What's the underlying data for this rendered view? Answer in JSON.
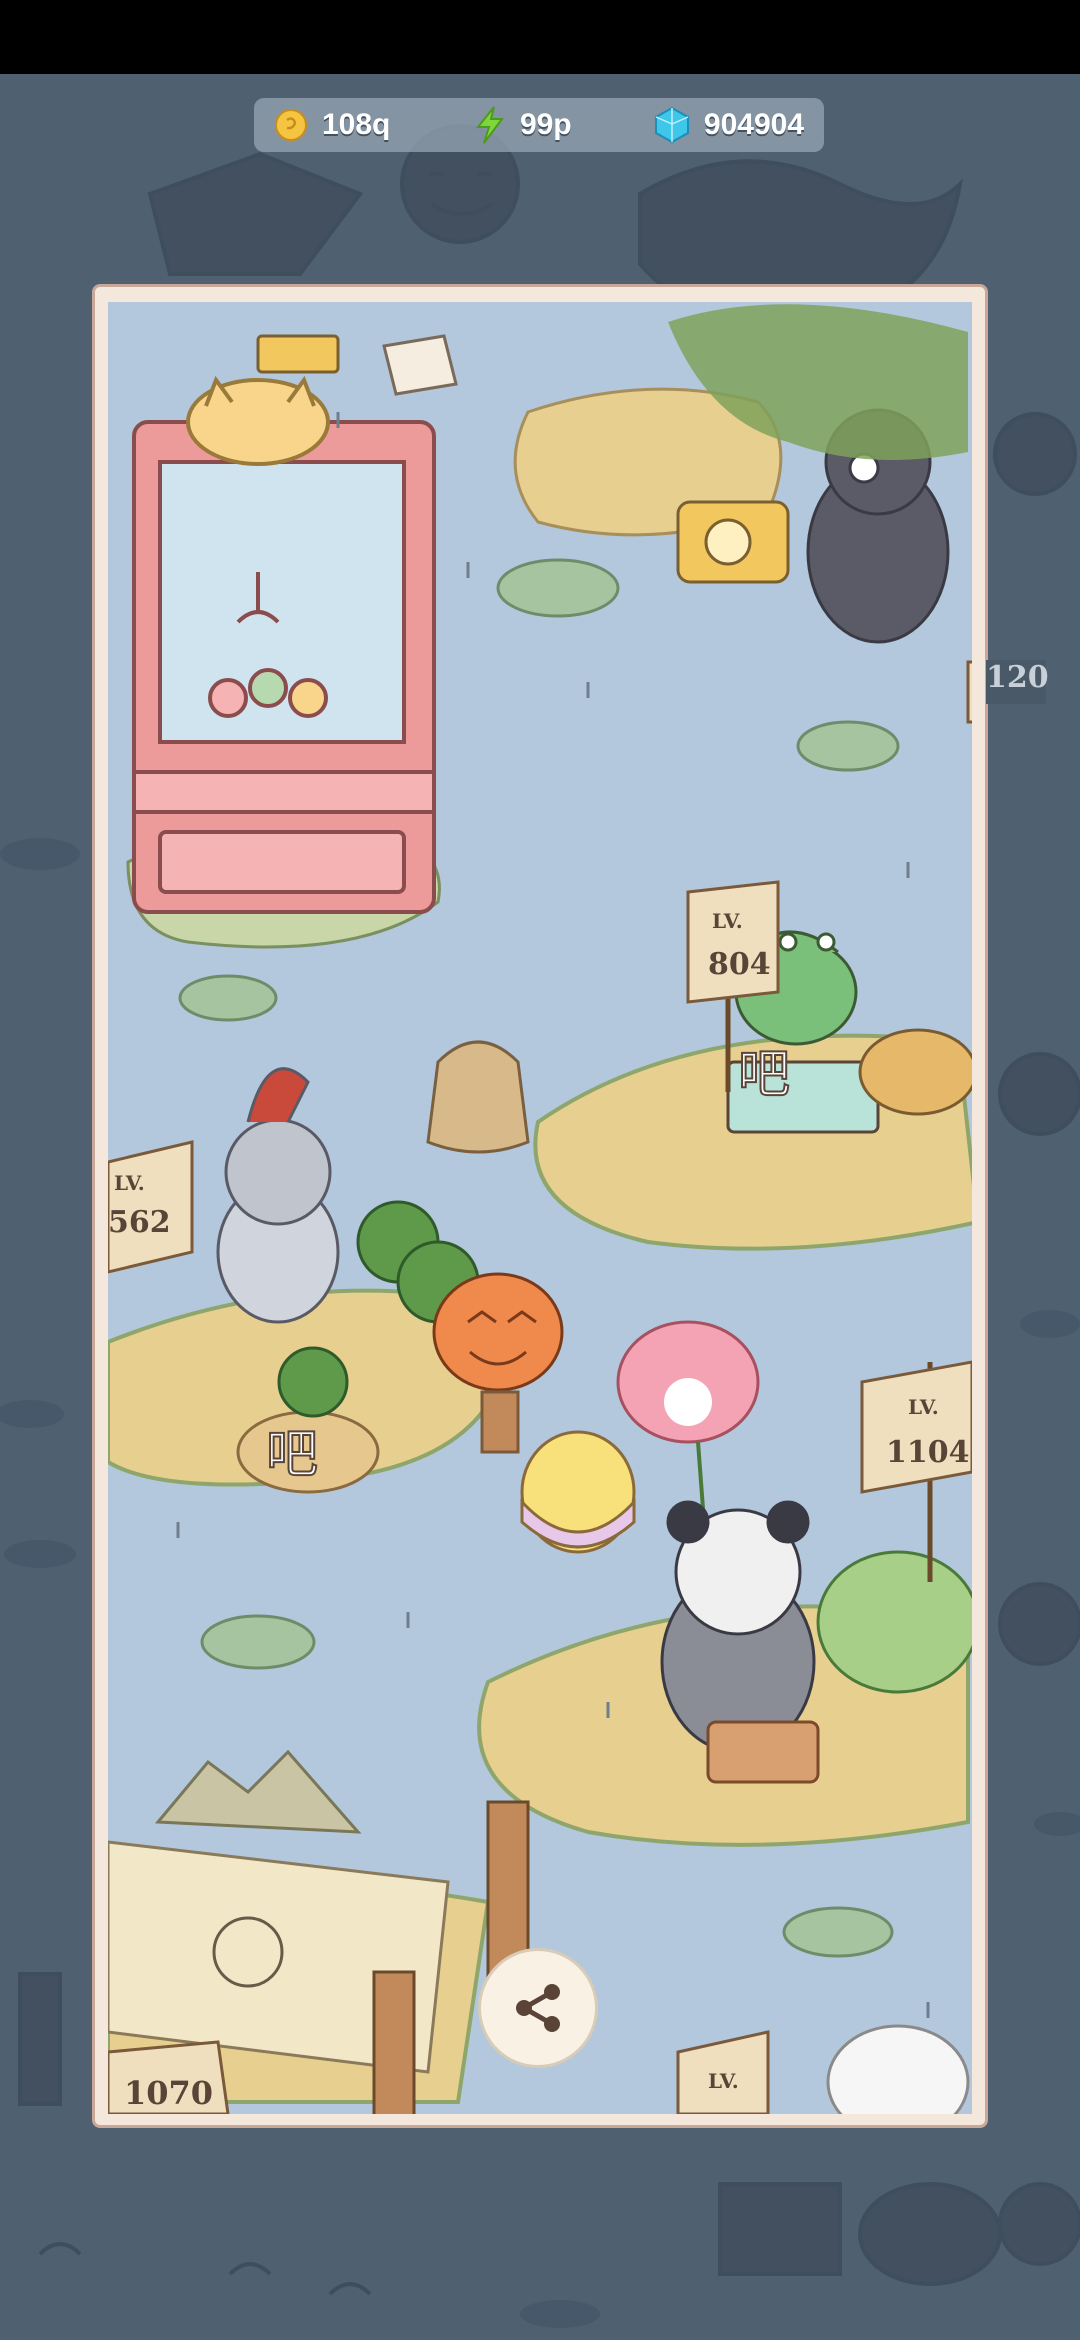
{
  "status_bar": {},
  "currency": {
    "coins": "108q",
    "energy": "99p",
    "gems": "904904"
  },
  "level_signs": {
    "crocodile_station": "LV.\n804",
    "knight_station": "LV.\n562",
    "panda_station": "LV.\n1104",
    "top_right_sign": "120",
    "bottom_left_sign": "1070",
    "bottom_right_sign": "LV."
  },
  "speech": {
    "croc_word": "吧",
    "knight_word": "吧"
  },
  "machine": {
    "display": "ꟾꟾꟾ​ꟾꟾꟾ"
  },
  "colors": {
    "coin": "#f5c542",
    "energy": "#7fd63a",
    "gem": "#3ec7e8",
    "frame": "#f4e8dc",
    "water": "#b3c8dc"
  },
  "icons": [
    "coin-icon",
    "energy-icon",
    "gem-icon",
    "share-icon"
  ]
}
